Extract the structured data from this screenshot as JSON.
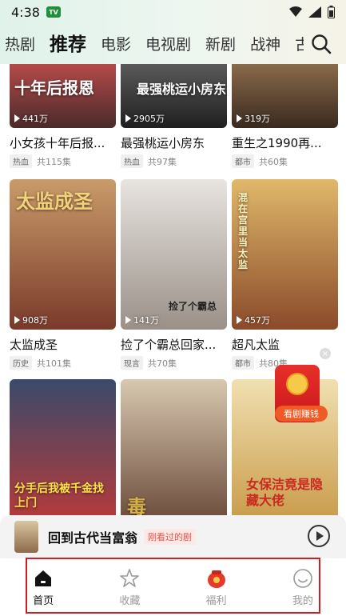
{
  "status_bar": {
    "time": "4:38",
    "app_badge": "TV"
  },
  "tabs": [
    "热剧",
    "推荐",
    "电影",
    "电视剧",
    "新剧",
    "战神",
    "古"
  ],
  "active_tab": "推荐",
  "cards": [
    {
      "title": "小女孩十年后报...",
      "views": "441万",
      "tag": "热血",
      "episodes": "共115集",
      "poster_text": "十年后报恩",
      "c1": "#b64a4a",
      "c2": "#4a2a2a"
    },
    {
      "title": "最强桃运小房东",
      "views": "2905万",
      "tag": "热血",
      "episodes": "共97集",
      "poster_text": "最强桃运小房东",
      "c1": "#5a5a5a",
      "c2": "#1f1f1f"
    },
    {
      "title": "重生之1990再...",
      "views": "319万",
      "tag": "都市",
      "episodes": "共60集",
      "poster_text": "",
      "c1": "#8a6a4a",
      "c2": "#3a2a1f"
    },
    {
      "title": "太监成圣",
      "views": "908万",
      "tag": "历史",
      "episodes": "共101集",
      "poster_text": "太监成圣",
      "c1": "#c99b6a",
      "c2": "#7a3a2a"
    },
    {
      "title": "捡了个霸总回家...",
      "views": "141万",
      "tag": "现言",
      "episodes": "共70集",
      "poster_text": "捡了个霸总",
      "c1": "#e8e4e0",
      "c2": "#9a9088"
    },
    {
      "title": "超凡太监",
      "views": "457万",
      "tag": "都市",
      "episodes": "共80集",
      "poster_text": "混在宫里当太监",
      "c1": "#e0b86a",
      "c2": "#8a4a2a"
    },
    {
      "title": "",
      "views": "",
      "tag": "",
      "episodes": "",
      "poster_text": "分手后我被千金找上门",
      "c1": "#3a4a6a",
      "c2": "#b83a3a"
    },
    {
      "title": "",
      "views": "",
      "tag": "",
      "episodes": "",
      "poster_text": "毒",
      "c1": "#d8c8b0",
      "c2": "#6a4a3a"
    },
    {
      "title": "",
      "views": "",
      "tag": "",
      "episodes": "",
      "poster_text": "女保洁竟是隐藏大佬",
      "c1": "#f0e0b0",
      "c2": "#c89a4a"
    }
  ],
  "envelope": {
    "label": "看剧赚钱",
    "close": "×"
  },
  "recent": {
    "title": "回到古代当富翁",
    "tag": "刚看过的剧"
  },
  "bottom_nav": [
    {
      "label": "首页",
      "icon": "home-icon",
      "active": true
    },
    {
      "label": "收藏",
      "icon": "star-icon",
      "active": false
    },
    {
      "label": "福利",
      "icon": "gift-bag-icon",
      "active": false
    },
    {
      "label": "我的",
      "icon": "smile-icon",
      "active": false
    }
  ]
}
